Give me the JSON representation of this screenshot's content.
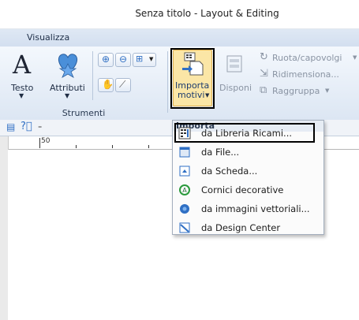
{
  "window": {
    "title": "Senza titolo - Layout & Editing"
  },
  "tabs": {
    "visualizza": "Visualizza"
  },
  "ribbon": {
    "strumenti": {
      "group_label": "Strumenti",
      "testo": "Testo",
      "attributi": "Attributi"
    },
    "importa_group": {
      "group_label": "Importa",
      "importa_line1": "Importa",
      "importa_line2": "motivi",
      "disponi": "Disponi",
      "ruota": "Ruota/capovolgi",
      "ridimensiona": "Ridimensiona...",
      "raggruppa": "Raggruppa"
    }
  },
  "ruler": {
    "label_50": "50"
  },
  "menu": {
    "items": [
      {
        "label": "da Libreria Ricami...",
        "icon": "library-icon"
      },
      {
        "label": "da File...",
        "icon": "file-icon"
      },
      {
        "label": "da Scheda...",
        "icon": "card-icon"
      },
      {
        "label": "Cornici decorative",
        "icon": "frame-icon"
      },
      {
        "label": "da immagini vettoriali...",
        "icon": "vector-icon"
      },
      {
        "label": "da Design Center",
        "icon": "design-center-icon"
      }
    ]
  },
  "colors": {
    "accent": "#2f6fc4",
    "heart": "#4a8fd9",
    "highlight": "#f2c25a"
  }
}
